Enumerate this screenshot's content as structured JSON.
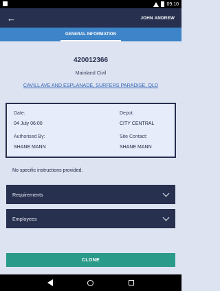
{
  "statusbar": {
    "time": "09:10"
  },
  "appbar": {
    "user": "JOHN ANDREW"
  },
  "tabs": [
    {
      "label": "GENERAL INFORMATION"
    }
  ],
  "job": {
    "number": "420012366",
    "type": "Mainland Civil",
    "address": "CAVILL AVE AND ESPLANADE, SURFERS PARADISE, QLD"
  },
  "details": {
    "date_label": "Date:",
    "date_value": "04 July 06:00",
    "depot_label": "Depot:",
    "depot_value": "CITY CENTRAL",
    "authorised_label": "Authorised By:",
    "authorised_value": "SHANE MANN",
    "site_contact_label": "Site Contact:",
    "site_contact_value": "SHANE MANN"
  },
  "instructions": "No specific instructions provided.",
  "sections": [
    {
      "label": "Requirements"
    },
    {
      "label": "Employees"
    }
  ],
  "clone_label": "CLONE"
}
